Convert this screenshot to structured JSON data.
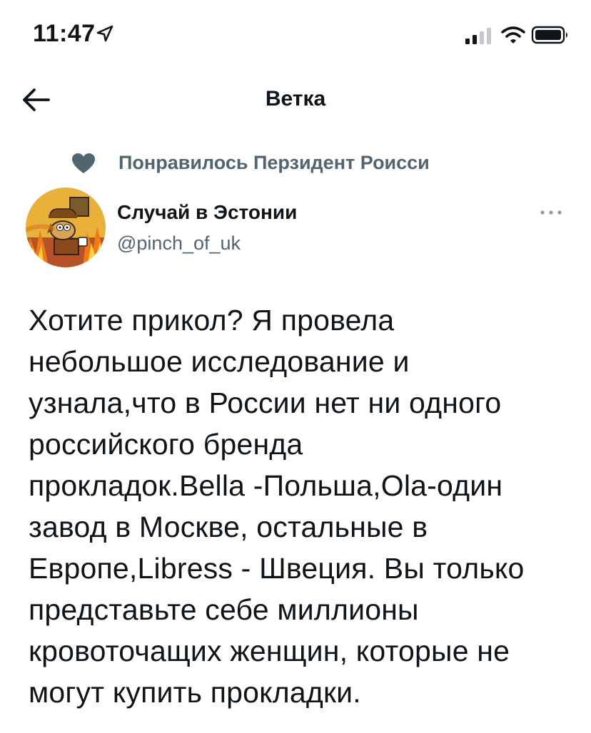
{
  "status_bar": {
    "time": "11:47",
    "icons": [
      "location-arrow-icon",
      "signal-icon",
      "wifi-icon",
      "battery-icon"
    ]
  },
  "header": {
    "back_icon": "arrow-left-icon",
    "title": "Ветка"
  },
  "social_context": {
    "icon": "heart-icon",
    "text": "Понравилось Перзидент Роисси"
  },
  "tweet": {
    "author": {
      "name": "Случай в Эстонии",
      "handle": "@pinch_of_uk",
      "avatar_icon": "this-is-fine-dog-icon"
    },
    "more_icon": "more-dots-icon",
    "text_lines": [
      "Хотите прикол? Я провела",
      "небольшое исследование и",
      "узнала,что в России нет ни одного",
      "российского бренда",
      "прокладок.Bella -Польша,Ola-один",
      "завод в Москве, остальные в",
      "Европе,Libress - Швеция. Вы только",
      "представьте себе миллионы",
      "кровоточащих женщин, которые не",
      "могут купить прокладки."
    ]
  },
  "colors": {
    "text": "#0f1419",
    "secondary_text": "#536471",
    "background": "#ffffff"
  }
}
